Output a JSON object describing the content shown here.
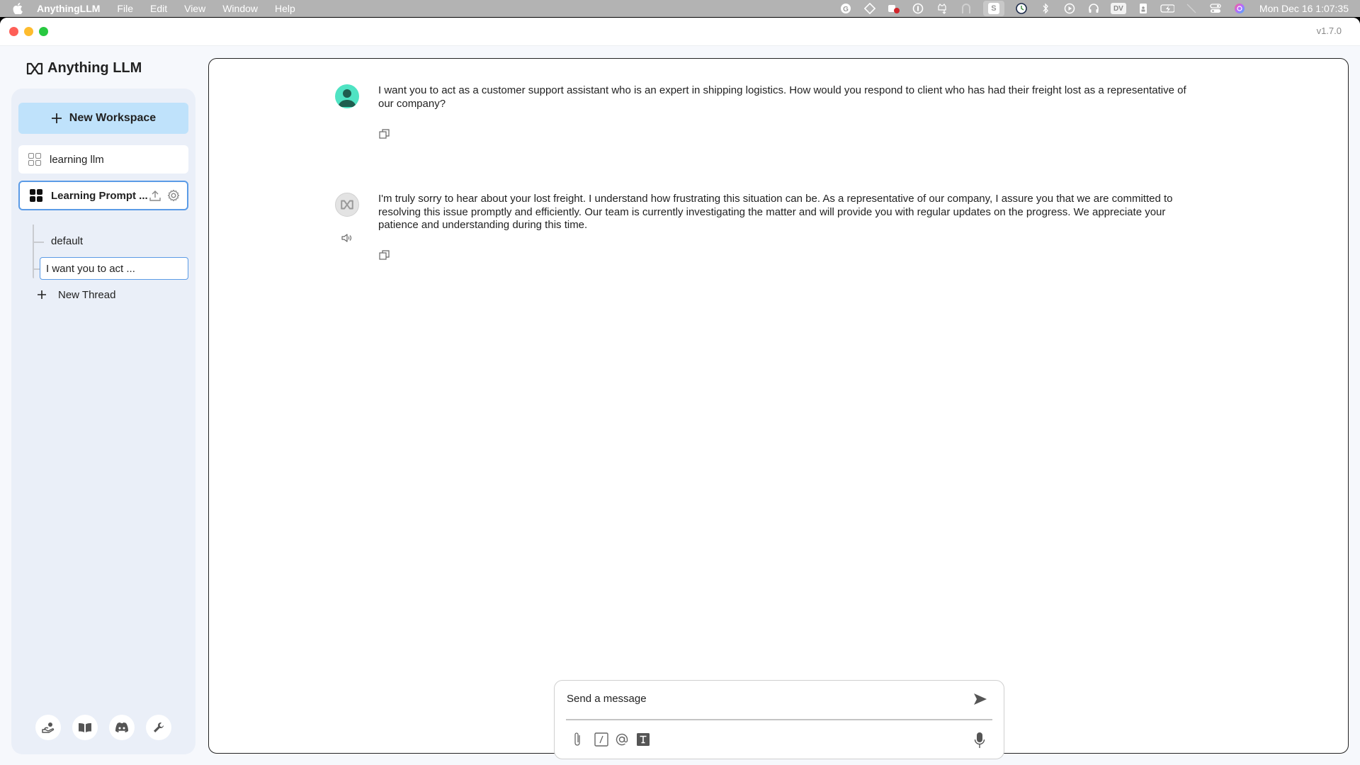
{
  "menubar": {
    "app_name": "AnythingLLM",
    "menus": [
      "File",
      "Edit",
      "View",
      "Window",
      "Help"
    ],
    "status_icons": [
      "grammarly-icon",
      "clipboard-icon",
      "teams-icon",
      "onepassword-icon",
      "cat-download-icon",
      "arc-icon",
      "skype-icon",
      "time-machine-icon",
      "bluetooth-icon",
      "play-icon",
      "headphones-icon",
      "dv-icon",
      "contacts-icon",
      "battery-icon",
      "wifi-off-icon",
      "control-center-icon",
      "siri-icon"
    ],
    "dv_label": "DV",
    "s_label": "S",
    "clock": "Mon Dec 16  1:07:35"
  },
  "window": {
    "version": "v1.7.0"
  },
  "sidebar": {
    "logo_text": "Anything LLM",
    "new_workspace_label": "New Workspace",
    "workspaces": [
      {
        "name": "learning llm",
        "active": false
      },
      {
        "name": "Learning Prompt ...",
        "active": true
      }
    ],
    "threads": [
      {
        "name": "default",
        "active": false
      },
      {
        "name": "I want you to act ...",
        "active": true
      }
    ],
    "new_thread_label": "New Thread",
    "footer_buttons": [
      "community-hub-icon",
      "docs-book-icon",
      "discord-icon",
      "settings-wrench-icon"
    ]
  },
  "chat": {
    "messages": [
      {
        "role": "user",
        "text": "I want you to act as a customer support assistant who is an expert in shipping logistics. How would you respond to client who has had their freight lost as a representative of our company?"
      },
      {
        "role": "assistant",
        "text": "I'm truly sorry to hear about your lost freight. I understand how frustrating this situation can be. As a representative of our company, I assure you that we are committed to resolving this issue promptly and efficiently. Our team is currently investigating the matter and will provide you with regular updates on the progress. We appreciate your patience and understanding during this time."
      }
    ]
  },
  "composer": {
    "placeholder": "Send a message",
    "value": ""
  }
}
